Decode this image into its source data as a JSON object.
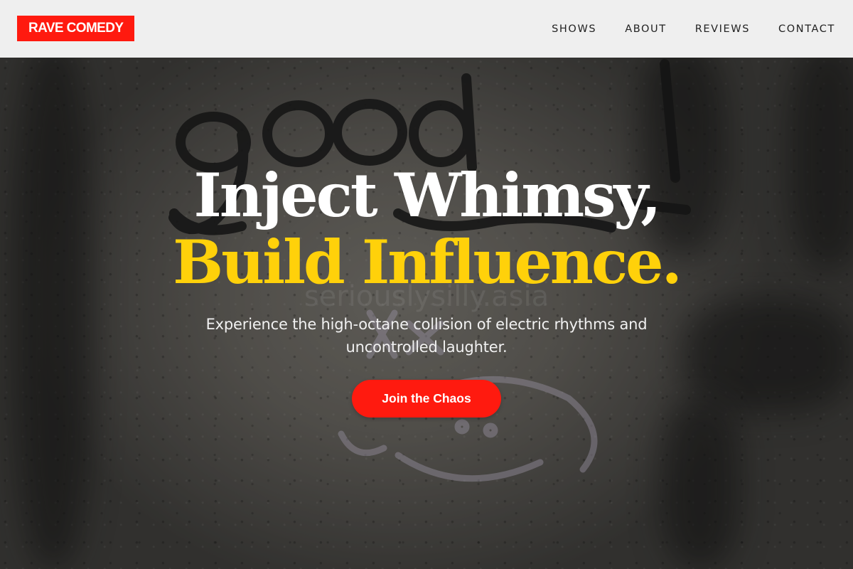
{
  "brand": {
    "logo_text": "RAVE COMEDY",
    "accent_color": "#ff1a0f"
  },
  "nav": {
    "items": [
      {
        "label": "SHOWS"
      },
      {
        "label": "ABOUT"
      },
      {
        "label": "REVIEWS"
      },
      {
        "label": "CONTACT"
      }
    ]
  },
  "hero": {
    "headline_line1": "Inject Whimsy,",
    "headline_line2": "Build Influence.",
    "headline_highlight_color": "#ffd10a",
    "subtitle": "Experience the high-octane collision of electric rhythms and uncontrolled laughter.",
    "cta_label": "Join the Chaos",
    "background_graffiti_text": "good",
    "background_watermark_text": "seriouslysilly.asia"
  }
}
